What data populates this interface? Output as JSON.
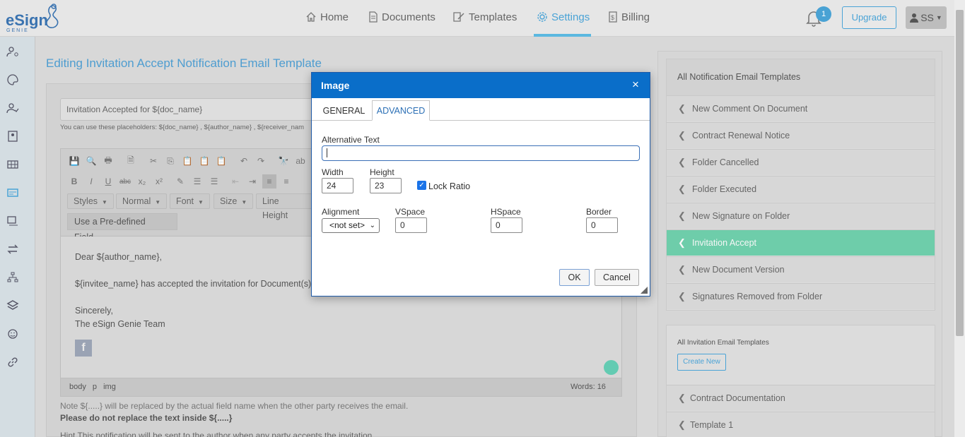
{
  "app": {
    "logo_text": "eSign",
    "logo_sub": "GENIE"
  },
  "nav": {
    "home": "Home",
    "documents": "Documents",
    "templates": "Templates",
    "settings": "Settings",
    "billing": "Billing",
    "active": "settings"
  },
  "header": {
    "notification_count": "1",
    "upgrade_label": "Upgrade",
    "user_initials": "SS"
  },
  "sidebar": {
    "icons": [
      "user-settings-icon",
      "palette-icon",
      "user-check-icon",
      "contact-card-icon",
      "table-icon",
      "email-template-icon",
      "signature-icon",
      "transfer-icon",
      "hierarchy-icon",
      "layers-icon",
      "smiley-icon",
      "link-icon"
    ]
  },
  "page": {
    "title": "Editing Invitation Accept Notification Email Template",
    "subject_value": "Invitation Accepted for ${doc_name}",
    "placeholders_hint": "You can use these placeholders:  ${doc_name} ,  ${author_name} ,  ${receiver_nam"
  },
  "editor": {
    "combos": {
      "styles": "Styles",
      "normal": "Normal",
      "font": "Font",
      "size": "Size",
      "line_height": "Line Height"
    },
    "predefined_label": "Use a Pre-defined Field",
    "body": {
      "line1": "Dear ${author_name},",
      "line2": "${invitee_name} has accepted the invitation for Document(s) tit",
      "line3": "Sincerely,",
      "line4": "The eSign Genie Team"
    },
    "status_path": "body  p  img",
    "words": "Words: 16"
  },
  "notes": {
    "note1": "Note ${.....} will be replaced by the actual field name when the other party receives the email.",
    "note2": "Please do not replace the text inside ${.....}",
    "note3": "Hint This notification will be sent to the author when any party accepts the invitation."
  },
  "right_panel": {
    "notification_header": "All Notification Email Templates",
    "notification_items": [
      "New Comment On Document",
      "Contract Renewal Notice",
      "Folder Cancelled",
      "Folder Executed",
      "New Signature on Folder",
      "Invitation Accept",
      "New Document Version",
      "Signatures Removed from Folder"
    ],
    "active_item": "Invitation Accept",
    "invitation_header": "All Invitation Email Templates",
    "create_new_label": "Create New",
    "invitation_items": [
      "Contract Documentation",
      "Template 1"
    ]
  },
  "dialog": {
    "title": "Image",
    "close_glyph": "×",
    "tabs": {
      "general": "GENERAL",
      "advanced": "ADVANCED"
    },
    "active_tab": "ADVANCED",
    "alt_text_label": "Alternative Text",
    "alt_text_value": "",
    "width_label": "Width",
    "width_value": "24",
    "height_label": "Height",
    "height_value": "23",
    "lock_ratio_label": "Lock Ratio",
    "lock_ratio_checked": true,
    "alignment_label": "Alignment",
    "alignment_value": "<not set>",
    "vspace_label": "VSpace",
    "vspace_value": "0",
    "hspace_label": "HSpace",
    "hspace_value": "0",
    "border_label": "Border",
    "border_value": "0",
    "ok_label": "OK",
    "cancel_label": "Cancel"
  },
  "colors": {
    "accent": "#4aa3d6",
    "dialog_header": "#0a6ec9",
    "active_item": "#6ecdaa"
  }
}
